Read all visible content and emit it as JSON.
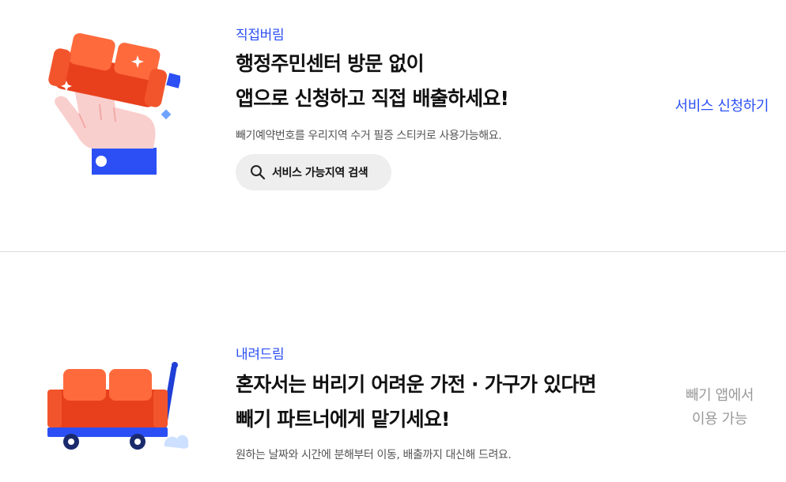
{
  "sections": [
    {
      "eyebrow": "직접버림",
      "headline": [
        "행정주민센터 방문 없이",
        "앱으로 신청하고 직접 배출하세요!"
      ],
      "description": "빼기예약번호를 우리지역 수거 필증 스티커로 사용가능해요.",
      "search_button_label": "서비스 가능지역 검색",
      "search_icon": "search-icon",
      "action_label": "서비스 신청하기",
      "illustration": "hand-holding-sofa-illustration"
    },
    {
      "eyebrow": "내려드림",
      "headline": [
        "혼자서는 버리기 어려운 가전 · 가구가 있다면",
        "빼기 파트너에게 맡기세요!"
      ],
      "description": "원하는 날짜와 시간에 분해부터 이동, 배출까지 대신해 드려요.",
      "app_note": [
        "빼기 앱에서",
        "이용 가능"
      ],
      "illustration": "hand-truck-sofa-illustration"
    }
  ],
  "colors": {
    "accent": "#2b4ff5",
    "sofa": "#f2552c",
    "muted": "#999999"
  }
}
